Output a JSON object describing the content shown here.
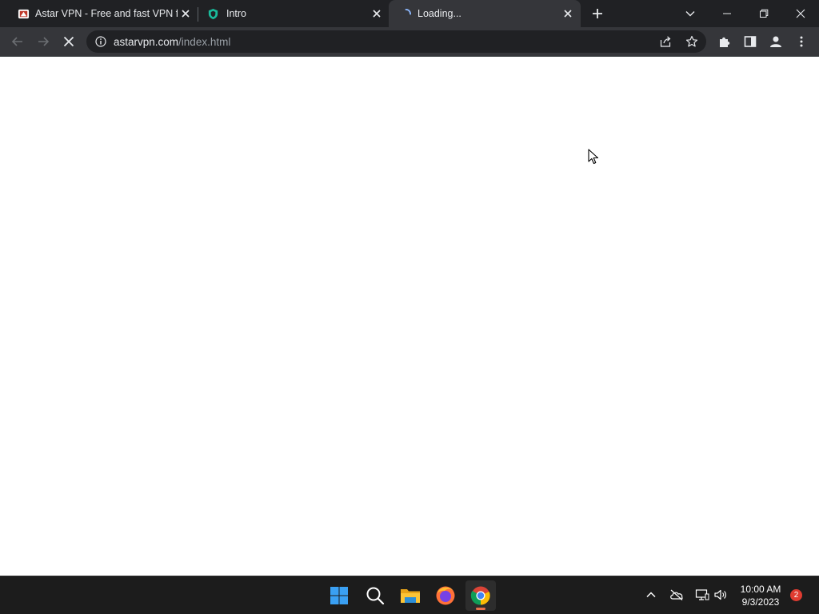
{
  "browser": {
    "tabs": [
      {
        "title": "Astar VPN - Free and fast VPN fo",
        "favicon": "astar-vpn-favicon",
        "active": false
      },
      {
        "title": "Intro",
        "favicon": "shield-favicon",
        "active": false
      },
      {
        "title": "Loading...",
        "favicon": "loading-spinner-icon",
        "active": true
      }
    ],
    "address_bar": {
      "domain": "astarvpn.com",
      "path": "/index.html"
    }
  },
  "taskbar": {
    "apps": [
      {
        "name": "windows-start",
        "icon": "windows-logo-icon"
      },
      {
        "name": "search",
        "icon": "search-icon"
      },
      {
        "name": "file-explorer",
        "icon": "folder-icon"
      },
      {
        "name": "firefox",
        "icon": "firefox-icon"
      },
      {
        "name": "chrome",
        "icon": "chrome-icon",
        "active": true
      }
    ],
    "clock": {
      "time": "10:00 AM",
      "date": "9/3/2023"
    },
    "notification_count": "2"
  },
  "colors": {
    "tabstrip": "#202124",
    "toolbar": "#35363a",
    "taskbar": "#1c1c1c",
    "accent": "#e6714b"
  }
}
